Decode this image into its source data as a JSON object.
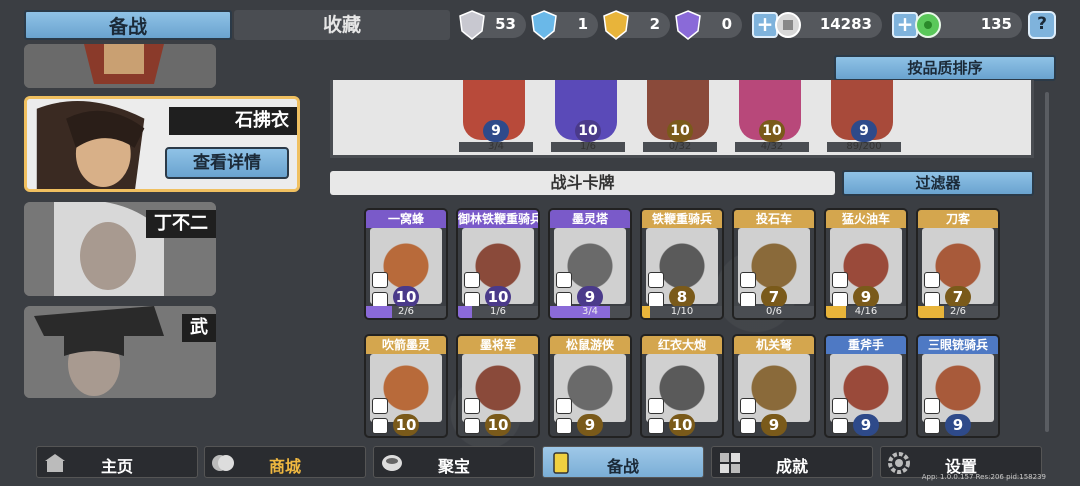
{
  "top": {
    "tab_prepare": "备战",
    "tab_collect": "收藏",
    "resources": [
      {
        "icon": "silver-shield-icon",
        "value": "53",
        "color": "#c8c8d0"
      },
      {
        "icon": "blue-shield-icon",
        "value": "1",
        "color": "#6ab8e8"
      },
      {
        "icon": "gold-shield-icon",
        "value": "2",
        "color": "#e8b43a"
      },
      {
        "icon": "purple-shield-icon",
        "value": "0",
        "color": "#8a6ad8"
      }
    ],
    "coins": "14283",
    "gems": "135",
    "help": "?"
  },
  "heroes": [
    {
      "name": "",
      "state": "partial"
    },
    {
      "name": "石拂衣",
      "state": "selected",
      "detail_button": "查看详情"
    },
    {
      "name": "丁不二",
      "state": "locked"
    },
    {
      "name": "武",
      "state": "locked"
    }
  ],
  "deck": {
    "sort_button": "按品质排序",
    "cards": [
      {
        "level": "9",
        "progress": "3/4",
        "fill": 0.75,
        "rarity": "blue"
      },
      {
        "level": "10",
        "progress": "1/6",
        "fill": 0.17,
        "rarity": "purple"
      },
      {
        "level": "10",
        "progress": "0/32",
        "fill": 0,
        "rarity": "gold"
      },
      {
        "level": "10",
        "progress": "4/32",
        "fill": 0.13,
        "rarity": "gold"
      },
      {
        "level": "9",
        "progress": "89/200",
        "fill": 0.45,
        "rarity": "blue"
      }
    ]
  },
  "battle_cards": {
    "title": "战斗卡牌",
    "filter_button": "过滤器",
    "row1": [
      {
        "name": "一窝蜂",
        "level": "10",
        "progress": "2/6",
        "fill": 0.33,
        "rarity": "purple"
      },
      {
        "name": "御林铁鞭重骑兵",
        "level": "10",
        "progress": "1/6",
        "fill": 0.17,
        "rarity": "purple"
      },
      {
        "name": "墨灵塔",
        "level": "9",
        "progress": "3/4",
        "fill": 0.75,
        "rarity": "purple"
      },
      {
        "name": "铁鞭重骑兵",
        "level": "8",
        "progress": "1/10",
        "fill": 0.1,
        "rarity": "gold"
      },
      {
        "name": "投石车",
        "level": "7",
        "progress": "0/6",
        "fill": 0,
        "rarity": "gold"
      },
      {
        "name": "猛火油车",
        "level": "9",
        "progress": "4/16",
        "fill": 0.25,
        "rarity": "gold"
      },
      {
        "name": "刀客",
        "level": "7",
        "progress": "2/6",
        "fill": 0.33,
        "rarity": "gold"
      }
    ],
    "row2": [
      {
        "name": "吹箭墨灵",
        "level": "10",
        "progress": "",
        "fill": 0,
        "rarity": "gold"
      },
      {
        "name": "墨将军",
        "level": "10",
        "progress": "",
        "fill": 0,
        "rarity": "gold"
      },
      {
        "name": "松鼠游侠",
        "level": "9",
        "progress": "",
        "fill": 0,
        "rarity": "gold"
      },
      {
        "name": "红衣大炮",
        "level": "10",
        "progress": "",
        "fill": 0,
        "rarity": "gold"
      },
      {
        "name": "机关弩",
        "level": "9",
        "progress": "",
        "fill": 0,
        "rarity": "gold"
      },
      {
        "name": "重斧手",
        "level": "9",
        "progress": "",
        "fill": 0,
        "rarity": "blue"
      },
      {
        "name": "三眼铳骑兵",
        "level": "9",
        "progress": "",
        "fill": 0,
        "rarity": "blue"
      }
    ]
  },
  "nav": [
    {
      "label": "主页",
      "icon": "home-icon",
      "active": false,
      "color": "#ffffff"
    },
    {
      "label": "商城",
      "icon": "coins-icon",
      "active": false,
      "color": "#f0b840"
    },
    {
      "label": "聚宝",
      "icon": "bowl-icon",
      "active": false,
      "color": "#ffffff"
    },
    {
      "label": "备战",
      "icon": "card-icon",
      "active": true,
      "color": "#1b2a38"
    },
    {
      "label": "成就",
      "icon": "trophy-icon",
      "active": false,
      "color": "#ffffff"
    },
    {
      "label": "设置",
      "icon": "gear-icon",
      "active": false,
      "color": "#ffffff"
    }
  ],
  "version": "App: 1.0.0.157 Res:206 pid:158239"
}
